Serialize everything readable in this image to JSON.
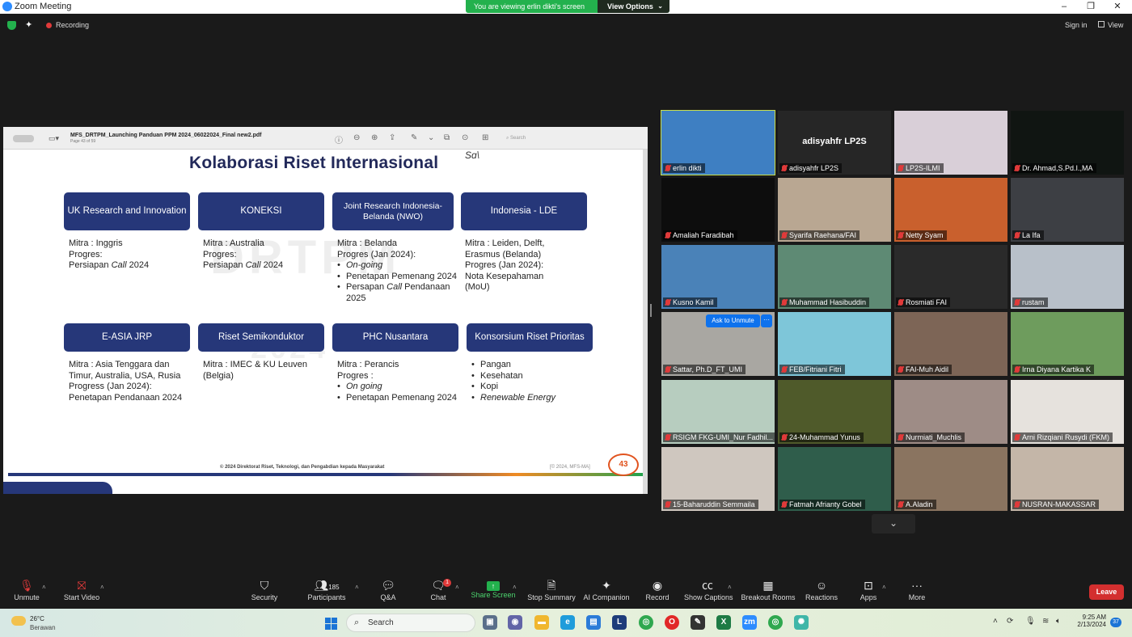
{
  "window": {
    "title": "Zoom Meeting",
    "banner_text": "You are viewing erlin dikti's screen",
    "view_options": "View Options",
    "minimize": "–",
    "maximize": "❐",
    "close": "✕"
  },
  "topbar": {
    "recording_label": "Recording",
    "sign_in": "Sign in",
    "view": "View"
  },
  "pdf": {
    "filename": "MFS_DRTPM_Launching Panduan PPM 2024_06022024_Final new2.pdf",
    "page_info": "Page 43 of 59",
    "search_placeholder": "Search"
  },
  "slide": {
    "title": "Kolaborasi Riset Internasional",
    "logo_text": "Sɑ\\",
    "watermark": "DRTPM",
    "watermark2": "2024",
    "boxes": [
      {
        "label": "UK Research and Innovation"
      },
      {
        "label": "KONEKSI"
      },
      {
        "label": "Joint Research Indonesia-Belanda (NWO)"
      },
      {
        "label": "Indonesia - LDE"
      },
      {
        "label": "E-ASIA JRP"
      },
      {
        "label": "Riset Semikonduktor"
      },
      {
        "label": "PHC Nusantara"
      },
      {
        "label": "Konsorsium Riset Prioritas"
      }
    ],
    "uk": {
      "l1": "Mitra : Inggris",
      "l2": "Progres:",
      "l3a": "Persiapan ",
      "l3b": "Call",
      "l3c": " 2024"
    },
    "koneksi": {
      "l1": "Mitra : Australia",
      "l2": "Progres:",
      "l3a": "Persiapan ",
      "l3b": "Call",
      "l3c": " 2024"
    },
    "nwo": {
      "l1": "Mitra : Belanda",
      "l2": "Progres (Jan 2024):",
      "b1": "On-going",
      "b2": "Penetapan Pemenang 2024",
      "b3a": "Persapan ",
      "b3b": "Call",
      "b3c": " Pendanaan 2025"
    },
    "lde": {
      "l1": "Mitra : Leiden, Delft, Erasmus (Belanda)",
      "l2": "Progres (Jan 2024):",
      "l3": "Nota Kesepahaman (MoU)"
    },
    "easia": {
      "l1": "Mitra : Asia Tenggara dan Timur, Australia, USA, Rusia",
      "l2": "Progress (Jan 2024):",
      "l3": "Penetapan Pendanaan 2024"
    },
    "semikon": {
      "l1": "Mitra : IMEC & KU Leuven (Belgia)"
    },
    "phc": {
      "l1": "Mitra : Perancis",
      "l2": "Progres :",
      "b1": "On going",
      "b2": "Penetapan Pemenang 2024"
    },
    "konsorsium": {
      "b1": "Pangan",
      "b2": "Kesehatan",
      "b3": "Kopi",
      "b4": "Renewable Energy"
    },
    "footer": "© 2024 Direktorat Riset, Teknologi, dan Pengabdian kepada Masyarakat",
    "footer_right": "[© 2024, MFS-MA]",
    "page_number": "43"
  },
  "participants": [
    {
      "name": "erlin dikti",
      "bg": "#3e7fc2"
    },
    {
      "name": "adisyahfr LP2S",
      "bg": "#262626",
      "center": "adisyahfr LP2S"
    },
    {
      "name": "LP2S-ILMI",
      "bg": "#d9cfd8"
    },
    {
      "name": "Dr. Ahmad,S.Pd.I.,MA",
      "bg": "#101512"
    },
    {
      "name": "Amaliah Faradibah",
      "bg": "#0d0d0d"
    },
    {
      "name": "Syarifa Raehana/FAI",
      "bg": "#b9a792"
    },
    {
      "name": "Netty Syam",
      "bg": "#c9602d"
    },
    {
      "name": "La Ifa",
      "bg": "#3d3f44"
    },
    {
      "name": "Kusno Kamil",
      "bg": "#4a82b8"
    },
    {
      "name": "Muhammad Hasibuddin",
      "bg": "#5e8a74"
    },
    {
      "name": "Rosmiati FAI",
      "bg": "#2a2a2a"
    },
    {
      "name": "rustam",
      "bg": "#b8c0c9"
    },
    {
      "name": "Sattar, Ph.D_FT_UMI",
      "bg": "#a9a7a2"
    },
    {
      "name": "FEB/Fitriani Fitri",
      "bg": "#7ec6d9"
    },
    {
      "name": "FAI-Muh Aidil",
      "bg": "#7d6556"
    },
    {
      "name": "Irna Diyana Kartika K",
      "bg": "#6e9c5d"
    },
    {
      "name": "RSIGM FKG-UMI_Nur Fadhil...",
      "bg": "#b7cdbf"
    },
    {
      "name": "24-Muhammad Yunus",
      "bg": "#4f5a2a"
    },
    {
      "name": "Nurmiati_Muchlis",
      "bg": "#9e8c86"
    },
    {
      "name": "Arni Rizqiani Rusydi (FKM)",
      "bg": "#e6e2dd"
    },
    {
      "name": "15-Baharuddin Semmaila",
      "bg": "#cfc7bf"
    },
    {
      "name": "Fatmah Afrianty Gobel",
      "bg": "#2f5d4b"
    },
    {
      "name": "A.Aladin",
      "bg": "#8a7460"
    },
    {
      "name": "NUSRAN-MAKASSAR",
      "bg": "#c4b6a8"
    }
  ],
  "ask_to_unmute": "Ask to Unmute",
  "ask_more": "···",
  "toolbar": {
    "unmute": "Unmute",
    "start_video": "Start Video",
    "security": "Security",
    "participants": "Participants",
    "participants_count": "185",
    "qa": "Q&A",
    "chat": "Chat",
    "chat_badge": "1",
    "share_screen": "Share Screen",
    "stop_summary": "Stop Summary",
    "ai_companion": "AI Companion",
    "record": "Record",
    "show_captions": "Show Captions",
    "breakout_rooms": "Breakout Rooms",
    "reactions": "Reactions",
    "apps": "Apps",
    "more": "More",
    "leave": "Leave"
  },
  "taskbar": {
    "temperature": "26°C",
    "weather": "Berawan",
    "search": "Search",
    "time": "9:25 AM",
    "date": "2/13/2024",
    "notifications": "37"
  }
}
